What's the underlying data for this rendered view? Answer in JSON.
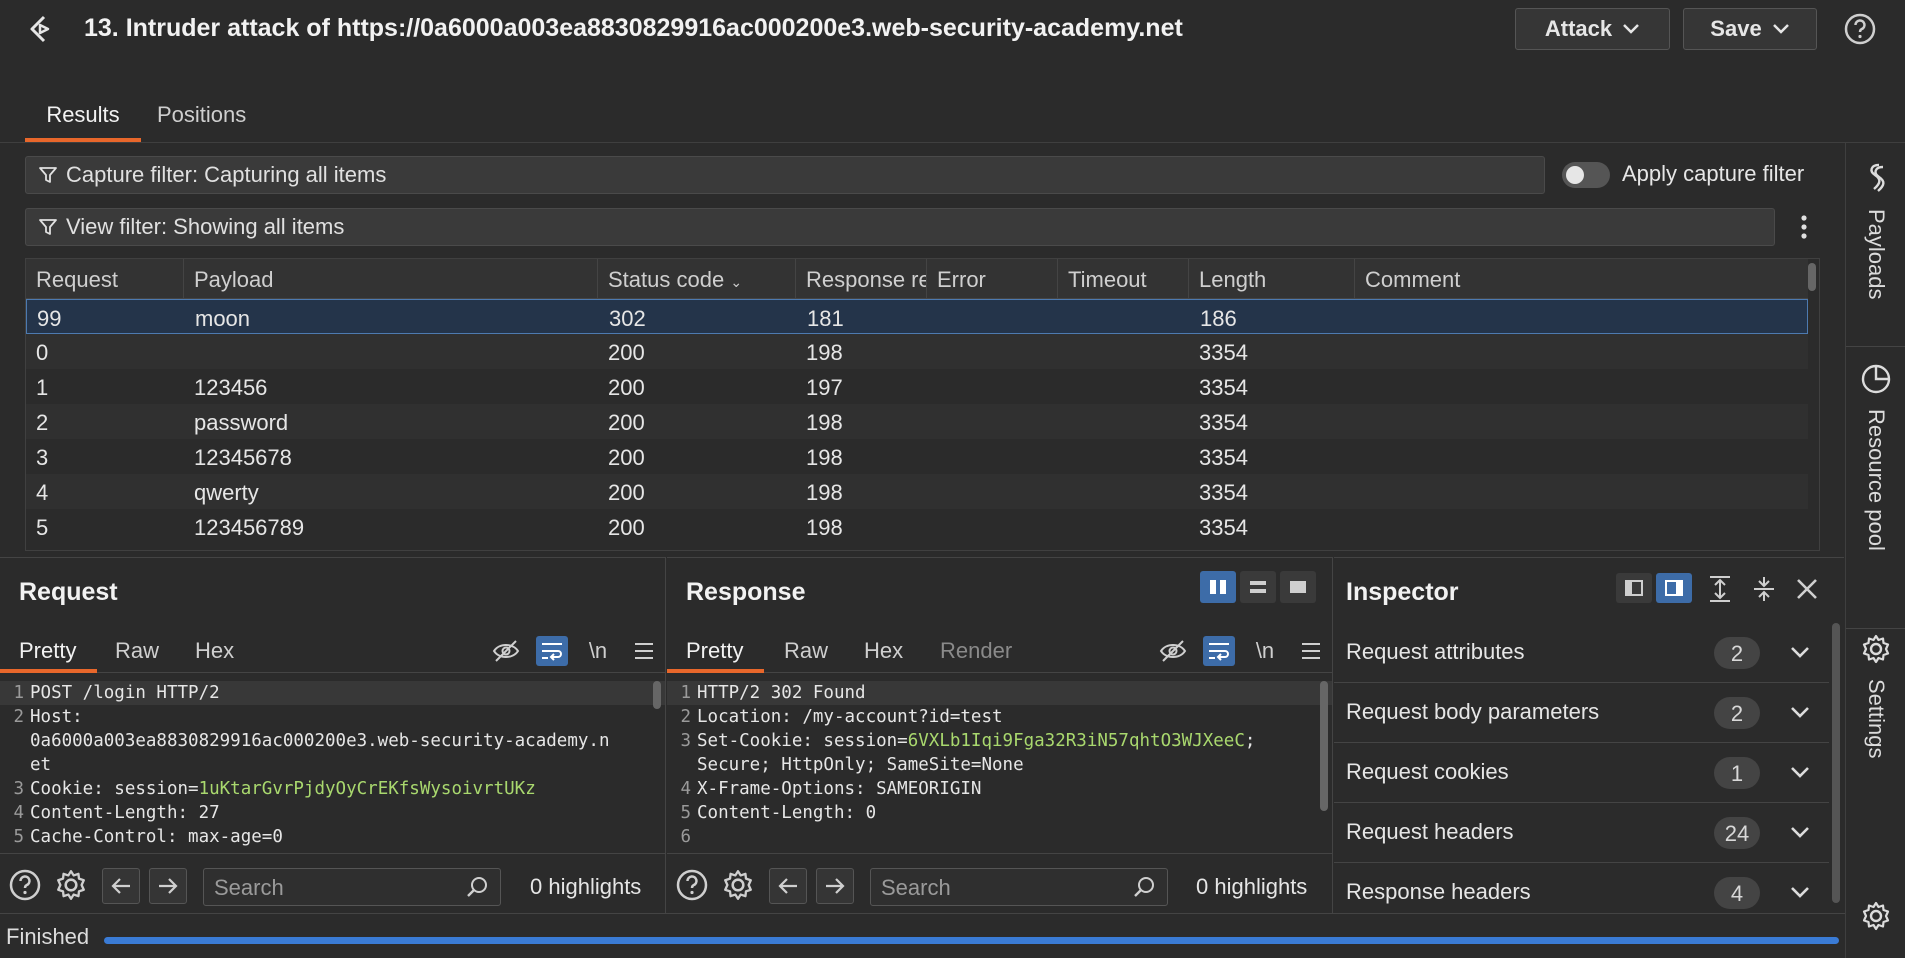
{
  "window": {
    "title": "13. Intruder attack of https://0a6000a003ea8830829916ac000200e3.web-security-academy.net",
    "attack_label": "Attack",
    "save_label": "Save"
  },
  "tabs": {
    "results": "Results",
    "positions": "Positions"
  },
  "filters": {
    "capture": "Capture filter: Capturing all items",
    "apply_capture": "Apply capture filter",
    "view": "View filter: Showing all items"
  },
  "table": {
    "headers": [
      "Request",
      "Payload",
      "Status code",
      "Response rec...",
      "Error",
      "Timeout",
      "Length",
      "Comment"
    ],
    "rows": [
      [
        "99",
        "moon",
        "302",
        "181",
        "",
        "",
        "186",
        ""
      ],
      [
        "0",
        "",
        "200",
        "198",
        "",
        "",
        "3354",
        ""
      ],
      [
        "1",
        "123456",
        "200",
        "197",
        "",
        "",
        "3354",
        ""
      ],
      [
        "2",
        "password",
        "200",
        "198",
        "",
        "",
        "3354",
        ""
      ],
      [
        "3",
        "12345678",
        "200",
        "198",
        "",
        "",
        "3354",
        ""
      ],
      [
        "4",
        "qwerty",
        "200",
        "198",
        "",
        "",
        "3354",
        ""
      ],
      [
        "5",
        "123456789",
        "200",
        "198",
        "",
        "",
        "3354",
        ""
      ]
    ]
  },
  "sidebar": {
    "payloads": "Payloads",
    "resource_pool": "Resource pool",
    "settings": "Settings"
  },
  "request": {
    "title": "Request",
    "tabs": [
      "Pretty",
      "Raw",
      "Hex"
    ],
    "newline_toggle": "\\n",
    "lines": [
      {
        "n": "1",
        "text": "POST /login HTTP/2"
      },
      {
        "n": "2",
        "text": "Host:"
      },
      {
        "n": "",
        "text": "0a6000a003ea8830829916ac000200e3.web-security-academy.n"
      },
      {
        "n": "",
        "text": "et"
      },
      {
        "n": "3",
        "key": "Cookie: session=",
        "val": "1uKtarGvrPjdyOyCrEKfsWysoivrtUKz"
      },
      {
        "n": "4",
        "text": "Content-Length: 27"
      },
      {
        "n": "5",
        "text": "Cache-Control: max-age=0"
      }
    ],
    "search_placeholder": "Search",
    "highlights": "0 highlights"
  },
  "response": {
    "title": "Response",
    "tabs": [
      "Pretty",
      "Raw",
      "Hex",
      "Render"
    ],
    "newline_toggle": "\\n",
    "lines": [
      {
        "n": "1",
        "text": "HTTP/2 302 Found"
      },
      {
        "n": "2",
        "text": "Location: /my-account?id=test"
      },
      {
        "n": "3",
        "key": "Set-Cookie: session=",
        "val": "6VXLb1Iqi9Fga32R3iN57qhtO3WJXeeC",
        "tail": ";"
      },
      {
        "n": "",
        "text": "Secure; HttpOnly; SameSite=None"
      },
      {
        "n": "4",
        "text": "X-Frame-Options: SAMEORIGIN"
      },
      {
        "n": "5",
        "text": "Content-Length: 0"
      },
      {
        "n": "6",
        "text": ""
      }
    ],
    "search_placeholder": "Search",
    "highlights": "0 highlights"
  },
  "inspector": {
    "title": "Inspector",
    "rows": [
      {
        "label": "Request attributes",
        "count": "2"
      },
      {
        "label": "Request body parameters",
        "count": "2"
      },
      {
        "label": "Request cookies",
        "count": "1"
      },
      {
        "label": "Request headers",
        "count": "24"
      },
      {
        "label": "Response headers",
        "count": "4"
      }
    ]
  },
  "status": {
    "text": "Finished",
    "progress": 1.0
  },
  "colors": {
    "accent": "#e8672b",
    "selection": "#3d6ca8",
    "cookie_value": "#a9d86e",
    "progress": "#3a7bd5"
  }
}
